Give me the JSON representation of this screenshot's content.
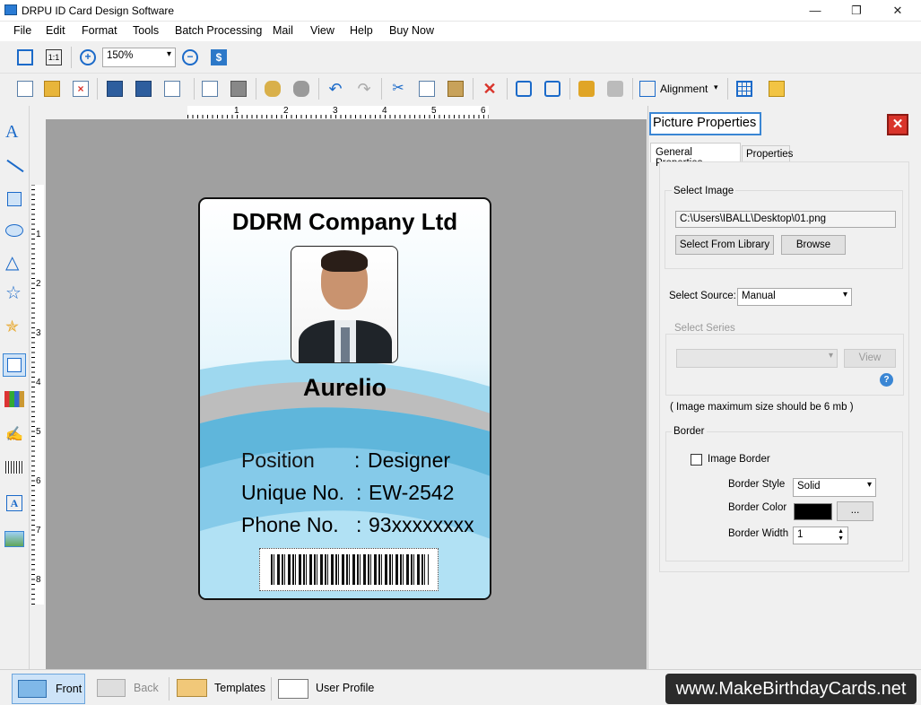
{
  "window": {
    "title": "DRPU ID Card Design Software",
    "min": "—",
    "max": "❐",
    "close": "✕"
  },
  "menu": [
    "File",
    "Edit",
    "Format",
    "Tools",
    "Batch Processing",
    "Mail",
    "View",
    "Help",
    "Buy Now"
  ],
  "toolbar1": {
    "zoom": "150%"
  },
  "toolbar2": {
    "alignment": "Alignment"
  },
  "ruler": {
    "h": [
      "1",
      "2",
      "3",
      "4",
      "5",
      "6"
    ],
    "v": [
      "1",
      "2",
      "3",
      "4",
      "5",
      "6",
      "7",
      "8"
    ]
  },
  "card": {
    "company": "DDRM Company Ltd",
    "name": "Aurelio",
    "rows": [
      {
        "label": "Position",
        "sep": ":",
        "value": "Designer"
      },
      {
        "label": "Unique No.",
        "sep": ":",
        "value": "EW-2542"
      },
      {
        "label": "Phone No.",
        "sep": ":",
        "value": "93xxxxxxxx"
      }
    ]
  },
  "panel": {
    "title": "Picture Properties",
    "tabs": [
      "General Properties",
      "Properties"
    ],
    "select_image": "Select Image",
    "path": "C:\\Users\\IBALL\\Desktop\\01.png",
    "btn_library": "Select From Library",
    "btn_browse": "Browse",
    "select_source": "Select Source:",
    "source_value": "Manual",
    "select_series": "Select Series",
    "btn_view": "View",
    "note": "( Image maximum size should be 6 mb )",
    "border": "Border",
    "image_border": "Image Border",
    "border_style": "Border Style",
    "style_value": "Solid",
    "border_color": "Border Color",
    "color_btn": "...",
    "border_width": "Border Width",
    "width_value": "1"
  },
  "bottom": {
    "front": "Front",
    "back": "Back",
    "templates": "Templates",
    "profile": "User Profile"
  },
  "watermark": "www.MakeBirthdayCards.net",
  "colors": {
    "accent": "#1b6ac9",
    "close_red": "#d9342b"
  }
}
